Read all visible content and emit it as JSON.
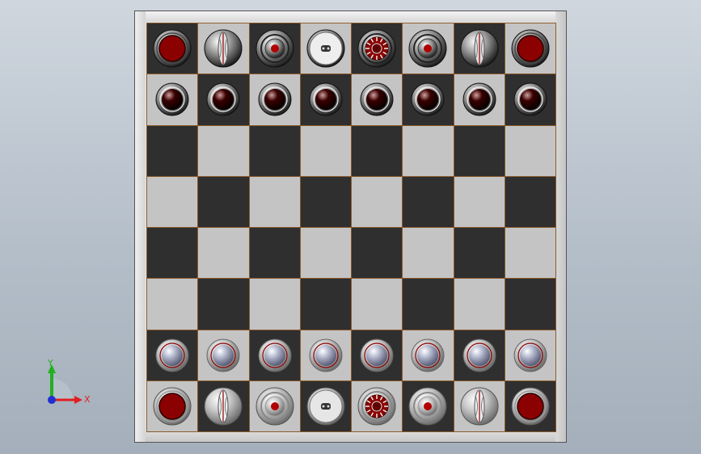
{
  "axes": {
    "x_label": "X",
    "y_label": "Y",
    "x_color": "#e02020",
    "y_color": "#20b020",
    "z_color": "#2030d0"
  },
  "colors": {
    "light_square": "#c4c4c4",
    "dark_square": "#2f2f2f",
    "grid_line": "#8a5a2b",
    "accent_red": "#8b0000"
  },
  "board": {
    "rows": [
      [
        "black-rook",
        "black-knight",
        "black-bishop",
        "black-queen",
        "black-king",
        "black-bishop",
        "black-knight",
        "black-rook"
      ],
      [
        "black-pawn",
        "black-pawn",
        "black-pawn",
        "black-pawn",
        "black-pawn",
        "black-pawn",
        "black-pawn",
        "black-pawn"
      ],
      [
        "",
        "",
        "",
        "",
        "",
        "",
        "",
        ""
      ],
      [
        "",
        "",
        "",
        "",
        "",
        "",
        "",
        ""
      ],
      [
        "",
        "",
        "",
        "",
        "",
        "",
        "",
        ""
      ],
      [
        "",
        "",
        "",
        "",
        "",
        "",
        "",
        ""
      ],
      [
        "white-pawn",
        "white-pawn",
        "white-pawn",
        "white-pawn",
        "white-pawn",
        "white-pawn",
        "white-pawn",
        "white-pawn"
      ],
      [
        "white-rook",
        "white-knight",
        "white-bishop",
        "white-queen",
        "white-king",
        "white-bishop",
        "white-knight",
        "white-rook"
      ]
    ]
  }
}
